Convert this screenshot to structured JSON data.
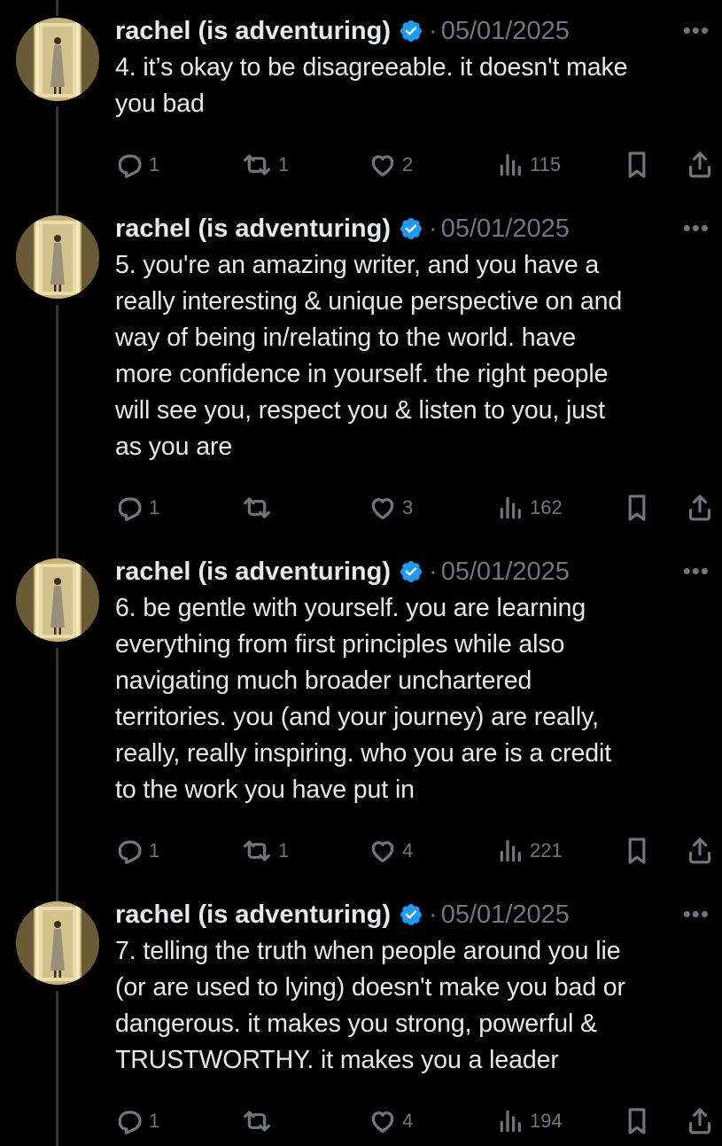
{
  "colors": {
    "background": "#000000",
    "text_primary": "#e7e9ea",
    "text_secondary": "#71767b",
    "verified_badge": "#1d9bf0",
    "thread_line": "#333639"
  },
  "author": {
    "display_name": "rachel (is adventuring)",
    "verified": true
  },
  "tweets": [
    {
      "date": "05/01/2025",
      "text": "4. it’s okay to be disagreeable. it doesn't make\nyou bad",
      "replies": "1",
      "reposts": "1",
      "likes": "2",
      "views": "115"
    },
    {
      "date": "05/01/2025",
      "text": "5. you're an amazing writer, and you have a\nreally interesting & unique perspective on and\nway of being in/relating to the world. have\nmore confidence in yourself. the right people\nwill see you, respect you & listen to you, just\nas you are",
      "replies": "1",
      "reposts": "",
      "likes": "3",
      "views": "162"
    },
    {
      "date": "05/01/2025",
      "text": "6. be gentle with yourself. you are learning\neverything from first principles while also\nnavigating much broader unchartered\nterritories. you (and your journey) are really,\nreally, really inspiring. who you are is a credit\nto the work you have put in",
      "replies": "1",
      "reposts": "1",
      "likes": "4",
      "views": "221"
    },
    {
      "date": "05/01/2025",
      "text": "7. telling the truth when people around you lie\n(or are used to lying) doesn't make you bad or\ndangerous. it makes you strong, powerful &\nTRUSTWORTHY. it makes you a leader",
      "replies": "1",
      "reposts": "",
      "likes": "4",
      "views": "194"
    }
  ],
  "icons": {
    "reply": "reply-icon",
    "repost": "repost-icon",
    "like": "heart-icon",
    "views": "views-icon",
    "bookmark": "bookmark-icon",
    "share": "share-icon",
    "more": "more-icon",
    "verified": "verified-badge-icon"
  },
  "separator": "·",
  "more_glyph": "•••"
}
